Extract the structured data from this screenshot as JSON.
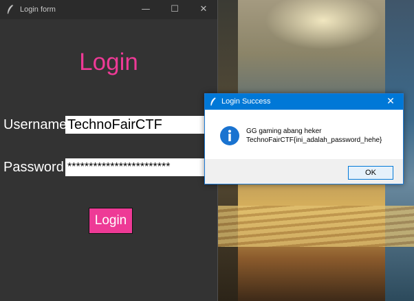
{
  "login_window": {
    "title": "Login form",
    "controls": {
      "minimize": "—",
      "maximize": "☐",
      "close": "✕"
    },
    "heading": "Login",
    "username_label": "Username",
    "username_value": "TechnoFairCTF",
    "password_label": "Password",
    "password_masked": "************************",
    "login_button": "Login",
    "colors": {
      "accent": "#ee3a96",
      "background": "#333333"
    }
  },
  "message_box": {
    "title": "Login Success",
    "close": "✕",
    "icon": "info-icon",
    "message_line1": "GG gaming abang heker",
    "message_line2": "TechnoFairCTF{ini_adalah_password_hehe}",
    "ok_button": "OK",
    "colors": {
      "titlebar": "#0078d7"
    }
  }
}
